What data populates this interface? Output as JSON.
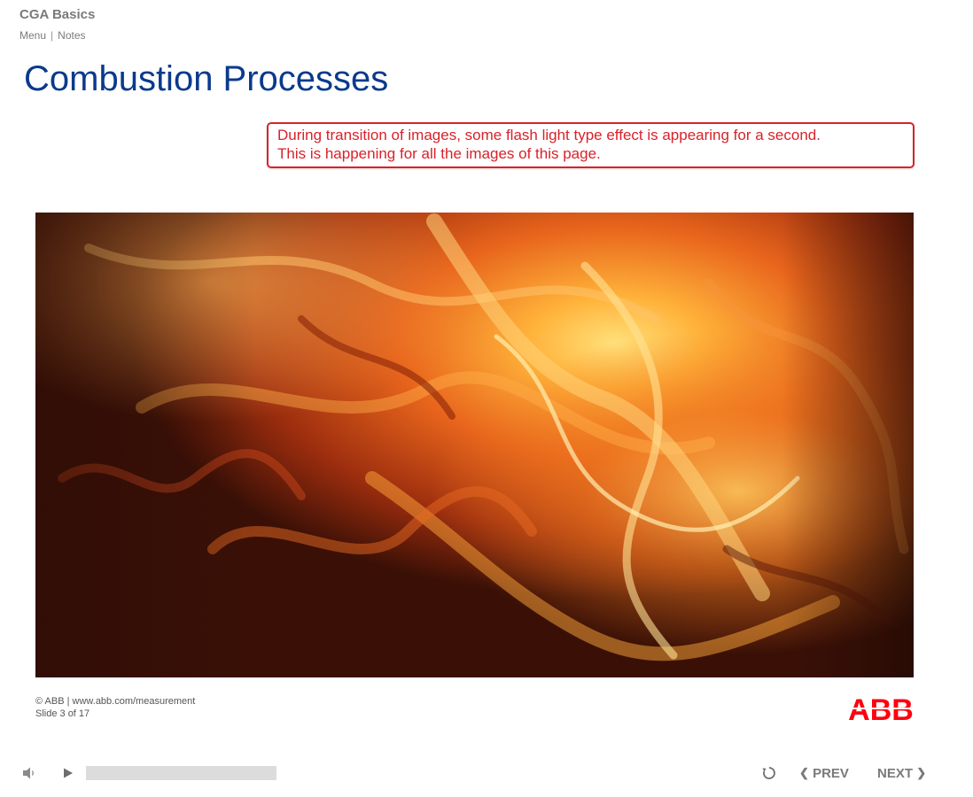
{
  "app": {
    "title": "CGA Basics",
    "nav": {
      "menu": "Menu",
      "separator": "|",
      "notes": "Notes"
    }
  },
  "slide": {
    "title": "Combustion Processes",
    "image": {
      "subject": "flames"
    }
  },
  "annotation": {
    "line1": "During transition of images, some flash light type effect is appearing for a second.",
    "line2": "This is happening for all the images of this page."
  },
  "footer": {
    "copyright": "© ABB | www.abb.com/measurement",
    "slide_counter": "Slide 3 of 17",
    "logo_text": "ABB"
  },
  "controls": {
    "icons": {
      "volume": "volume-icon",
      "play": "play-icon",
      "replay": "replay-icon"
    },
    "progress": 0,
    "prev_label": "PREV",
    "next_label": "NEXT"
  },
  "colors": {
    "title_blue": "#0a3a8c",
    "annotation_red": "#d8222a",
    "abb_red": "#ff000f",
    "ui_gray": "#7a7a7a"
  }
}
